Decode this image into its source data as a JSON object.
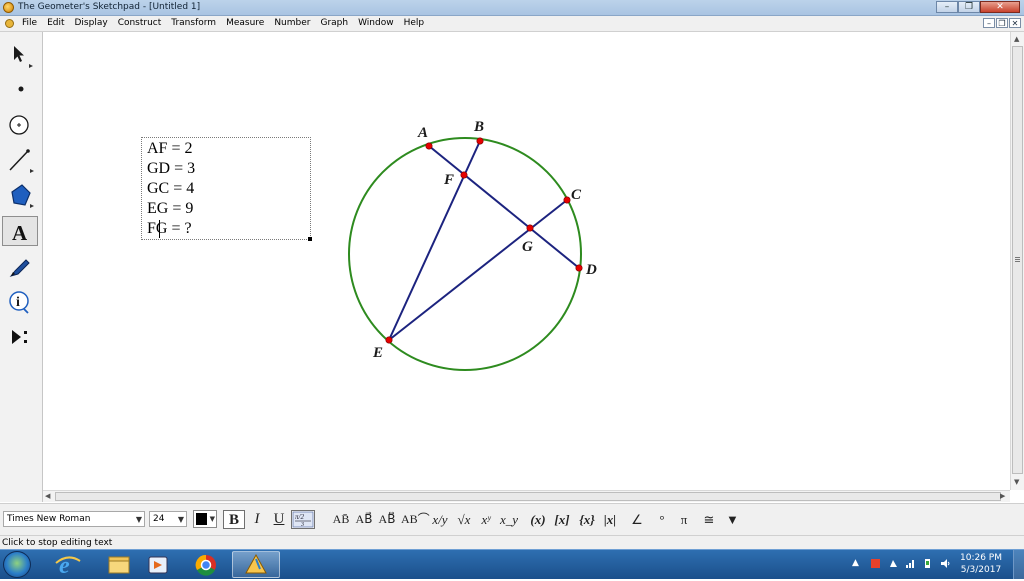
{
  "window": {
    "title": "The Geometer's Sketchpad - [Untitled 1]"
  },
  "menu": {
    "items": [
      "File",
      "Edit",
      "Display",
      "Construct",
      "Transform",
      "Measure",
      "Number",
      "Graph",
      "Window",
      "Help"
    ]
  },
  "toolbox": {
    "tools": [
      {
        "name": "selection-arrow-tool",
        "icon": "arrow-icon",
        "active": false
      },
      {
        "name": "point-tool",
        "icon": "point-icon",
        "active": false
      },
      {
        "name": "compass-tool",
        "icon": "compass-icon",
        "active": false
      },
      {
        "name": "straightedge-tool",
        "icon": "straightedge-icon",
        "active": false
      },
      {
        "name": "polygon-tool",
        "icon": "polygon-icon",
        "active": false
      },
      {
        "name": "text-tool",
        "icon": "text-a-icon",
        "label": "A",
        "active": true
      },
      {
        "name": "marker-tool",
        "icon": "marker-icon",
        "active": false
      },
      {
        "name": "information-tool",
        "icon": "info-icon",
        "label": "i",
        "active": false
      },
      {
        "name": "custom-tool",
        "icon": "custom-tool-icon",
        "active": false
      }
    ]
  },
  "caption": {
    "lines": [
      "AF = 2",
      "GD = 3",
      "GC = 4",
      "EG = 9",
      "FG = ?"
    ]
  },
  "diagram": {
    "colors": {
      "circle": "#2e8b1f",
      "segment": "#1c237f",
      "point": "#e60000"
    },
    "points": [
      {
        "label": "A"
      },
      {
        "label": "B"
      },
      {
        "label": "C"
      },
      {
        "label": "D"
      },
      {
        "label": "E"
      },
      {
        "label": "F"
      },
      {
        "label": "G"
      }
    ],
    "segments": [
      "AD",
      "BE",
      "EC"
    ]
  },
  "text_toolbar": {
    "font": "Times New Roman",
    "size": "24",
    "color": "#000000",
    "bold": "B",
    "italic": "I",
    "underline": "U",
    "math_buttons": [
      "AB̄",
      "AB⃗",
      "AB⃡",
      "AB⌒",
      "x/y",
      "√x",
      "xʸ",
      "x_y",
      "(x)",
      "[x]",
      "{x}",
      "|x|",
      "∠",
      "°",
      "π",
      "≅",
      "▼"
    ]
  },
  "status": {
    "text": "Click to stop editing text"
  },
  "taskbar": {
    "items": [
      {
        "name": "internet-explorer",
        "icon": "ie-icon",
        "active": false
      },
      {
        "name": "file-explorer",
        "icon": "folder-icon",
        "active": false
      },
      {
        "name": "media-player",
        "icon": "media-icon",
        "active": false
      },
      {
        "name": "chrome",
        "icon": "chrome-icon",
        "active": false
      },
      {
        "name": "sketchpad",
        "icon": "sketchpad-icon",
        "active": true
      }
    ],
    "clock_time": "10:26 PM",
    "clock_date": "5/3/2017"
  }
}
